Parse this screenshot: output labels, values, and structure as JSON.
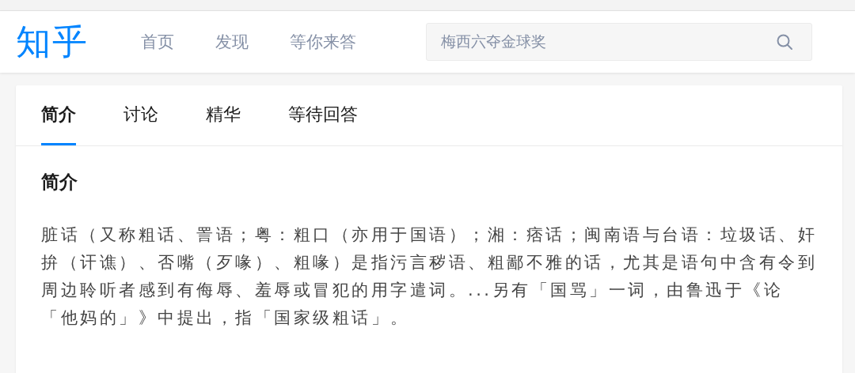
{
  "header": {
    "logo": "知乎",
    "nav": [
      {
        "label": "首页",
        "selected": false
      },
      {
        "label": "发现",
        "selected": false
      },
      {
        "label": "等你来答",
        "selected": false
      }
    ],
    "search": {
      "value": "梅西六夺金球奖"
    }
  },
  "tabs": [
    {
      "label": "简介",
      "selected": true
    },
    {
      "label": "讨论",
      "selected": false
    },
    {
      "label": "精华",
      "selected": false
    },
    {
      "label": "等待回答",
      "selected": false
    }
  ],
  "section": {
    "title": "简介",
    "text": "脏话（又称粗话、詈语；粤：粗口（亦用于国语）；湘：痞话；闽南语与台语：垃圾话、奸拚（讦谯）、否嘴（歹喙）、粗喙）是指污言秽语、粗鄙不雅的话，尤其是语句中含有令到周边聆听者感到有侮辱、羞辱或冒犯的用字遣词。...另有「国骂」一词，由鲁迅于《论「他妈的」》中提出，指「国家级粗话」。"
  }
}
